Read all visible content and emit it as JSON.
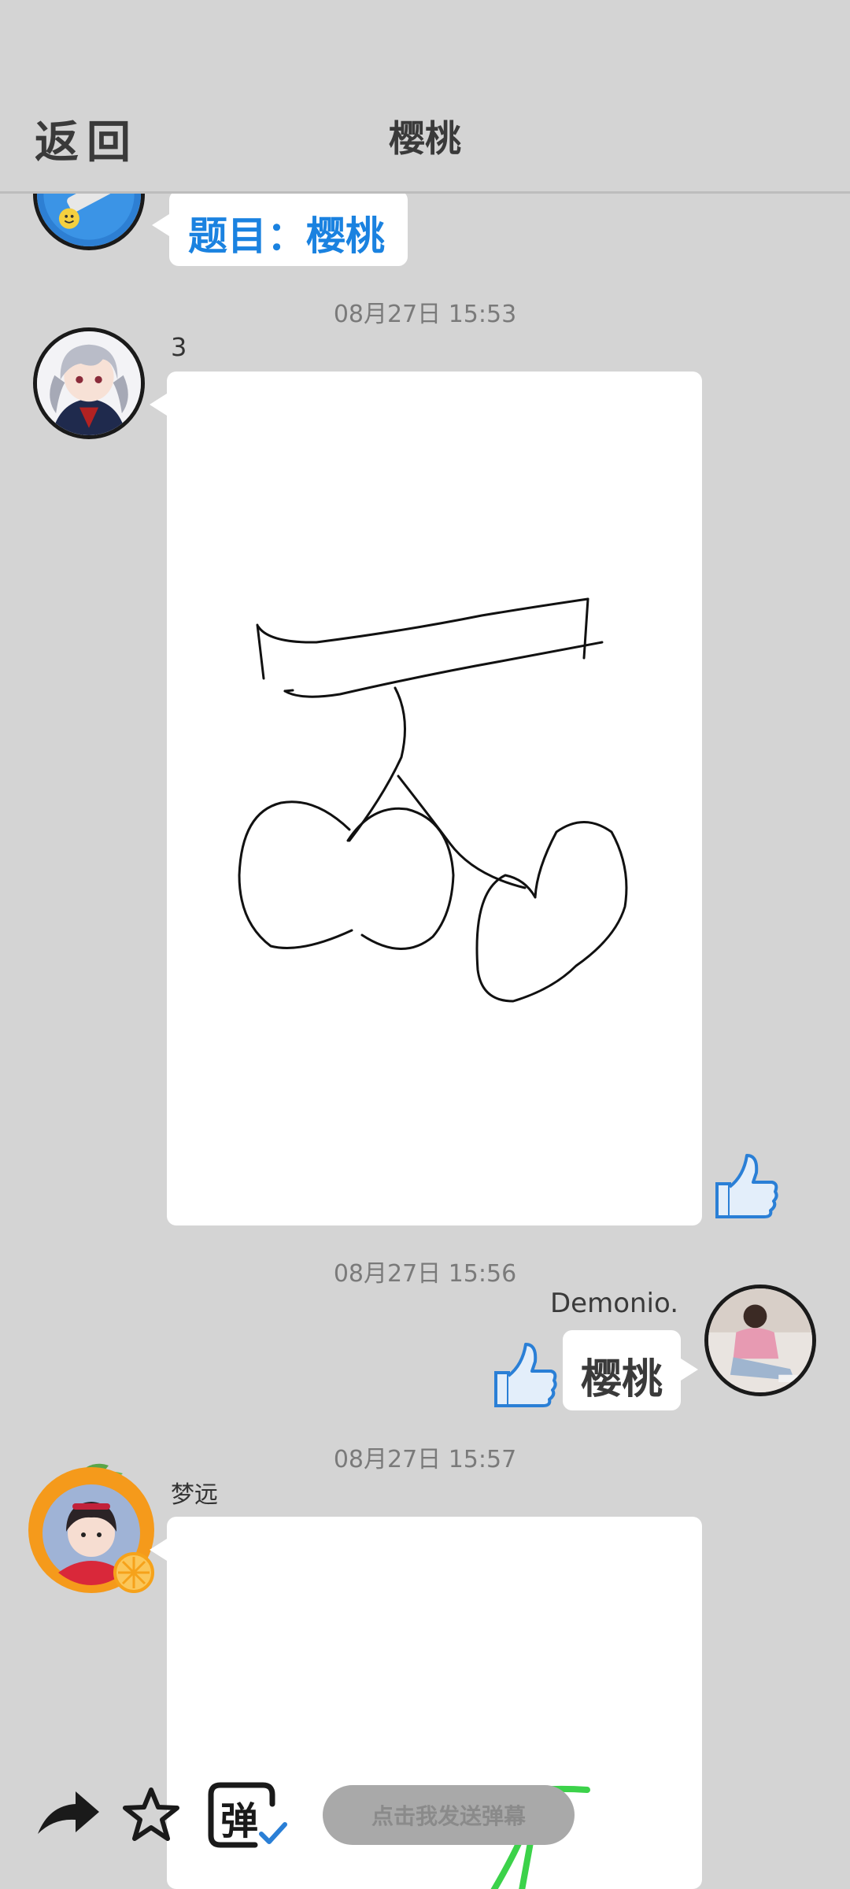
{
  "header": {
    "back_label": "返回",
    "title": "樱桃"
  },
  "topic": {
    "text": "题目：樱桃"
  },
  "messages": [
    {
      "timestamp": "08月27日  15:53",
      "username": "3"
    },
    {
      "timestamp": "08月27日  15:56",
      "username": "Demonio.",
      "answer": "樱桃"
    },
    {
      "timestamp": "08月27日  15:57",
      "username": "梦远"
    }
  ],
  "toolbar": {
    "danmaku_placeholder": "点击我发送弹幕",
    "danmaku_badge": "弹"
  },
  "colors": {
    "background": "#d4d4d4",
    "accent_blue": "#1a82e0",
    "like_blue": "#2a7fd6",
    "stroke_green": "#3cd24a"
  },
  "icons": [
    "share-arrow-icon",
    "star-icon",
    "danmaku-icon",
    "thumbs-up-icon"
  ]
}
